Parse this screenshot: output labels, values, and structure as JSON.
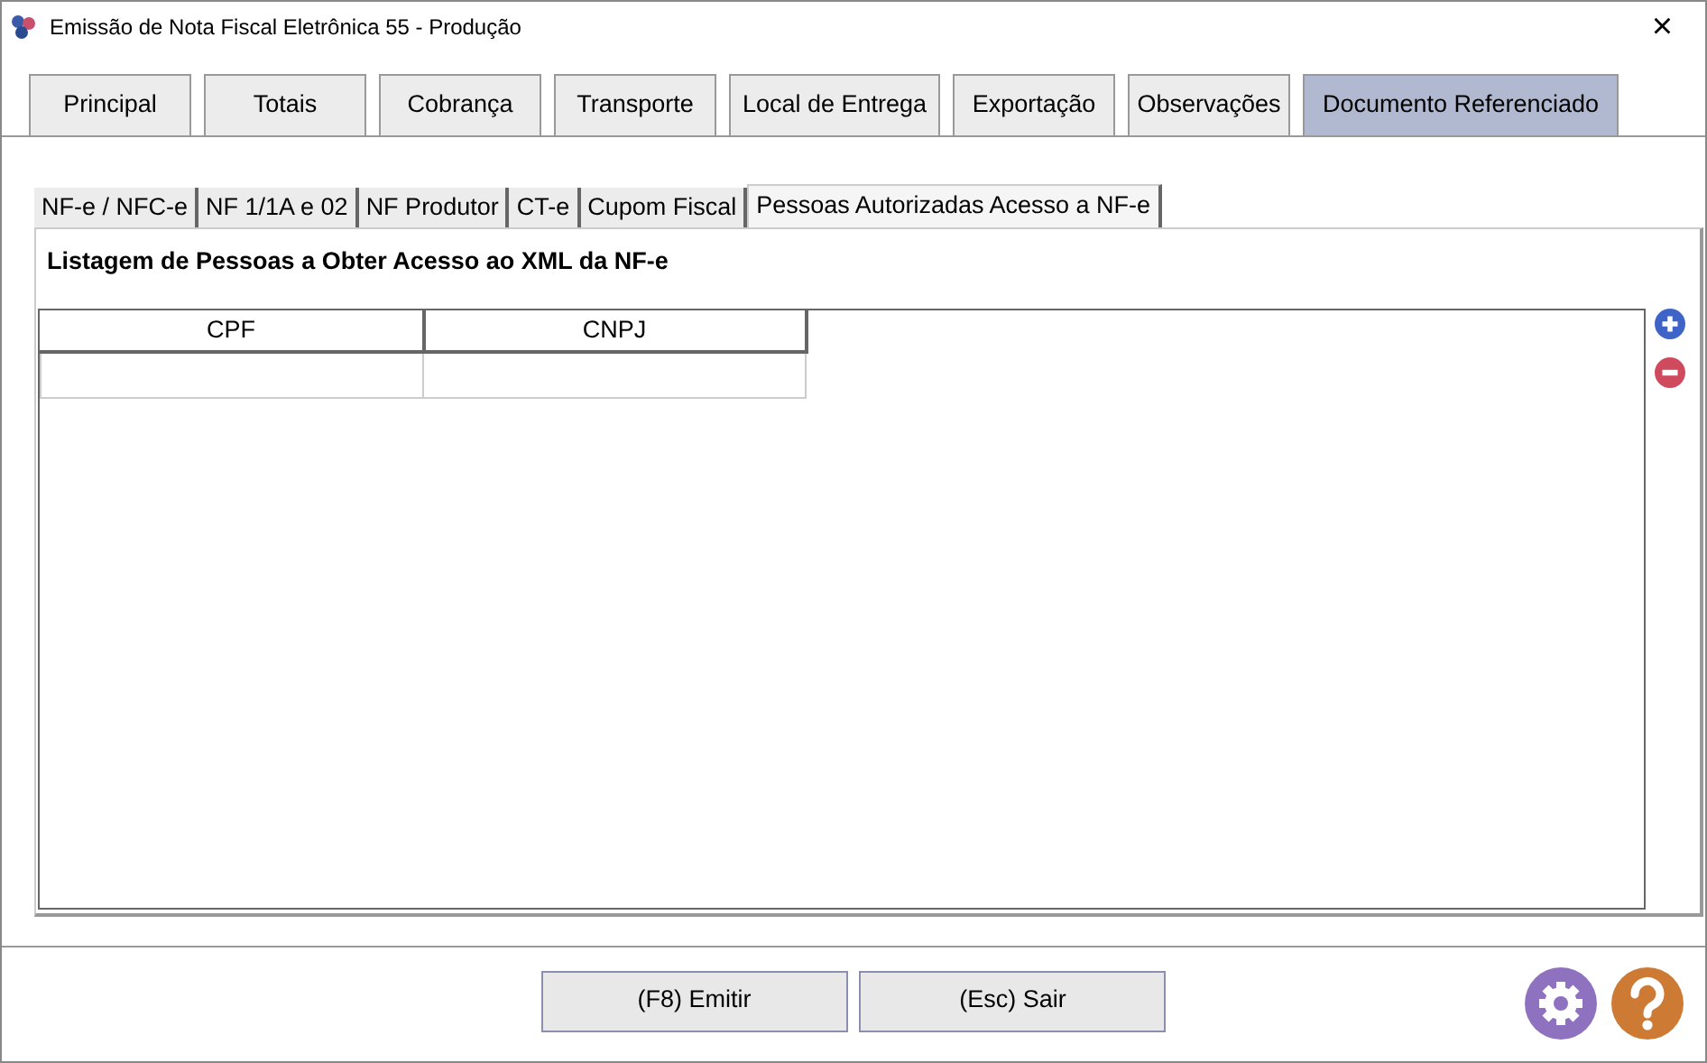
{
  "window": {
    "title": "Emissão de Nota Fiscal Eletrônica 55 - Produção",
    "close": "×"
  },
  "tabs": [
    {
      "label": "Principal",
      "selected": false
    },
    {
      "label": "Totais",
      "selected": false
    },
    {
      "label": "Cobrança",
      "selected": false
    },
    {
      "label": "Transporte",
      "selected": false
    },
    {
      "label": "Local de Entrega",
      "selected": false
    },
    {
      "label": "Exportação",
      "selected": false
    },
    {
      "label": "Observações",
      "selected": false
    },
    {
      "label": "Documento Referenciado",
      "selected": true
    }
  ],
  "subtabs": [
    {
      "label": "NF-e / NFC-e",
      "selected": false
    },
    {
      "label": "NF 1/1A e 02",
      "selected": false
    },
    {
      "label": "NF Produtor",
      "selected": false
    },
    {
      "label": "CT-e",
      "selected": false
    },
    {
      "label": "Cupom Fiscal",
      "selected": false
    },
    {
      "label": "Pessoas Autorizadas Acesso a NF-e",
      "selected": true
    }
  ],
  "section_title": "Listagem de Pessoas a Obter Acesso ao XML da NF-e",
  "table": {
    "columns": [
      "CPF",
      "CNPJ"
    ],
    "rows": [
      [
        "",
        ""
      ]
    ]
  },
  "buttons": [
    "(F8) Emitir",
    "(Esc) Sair"
  ]
}
